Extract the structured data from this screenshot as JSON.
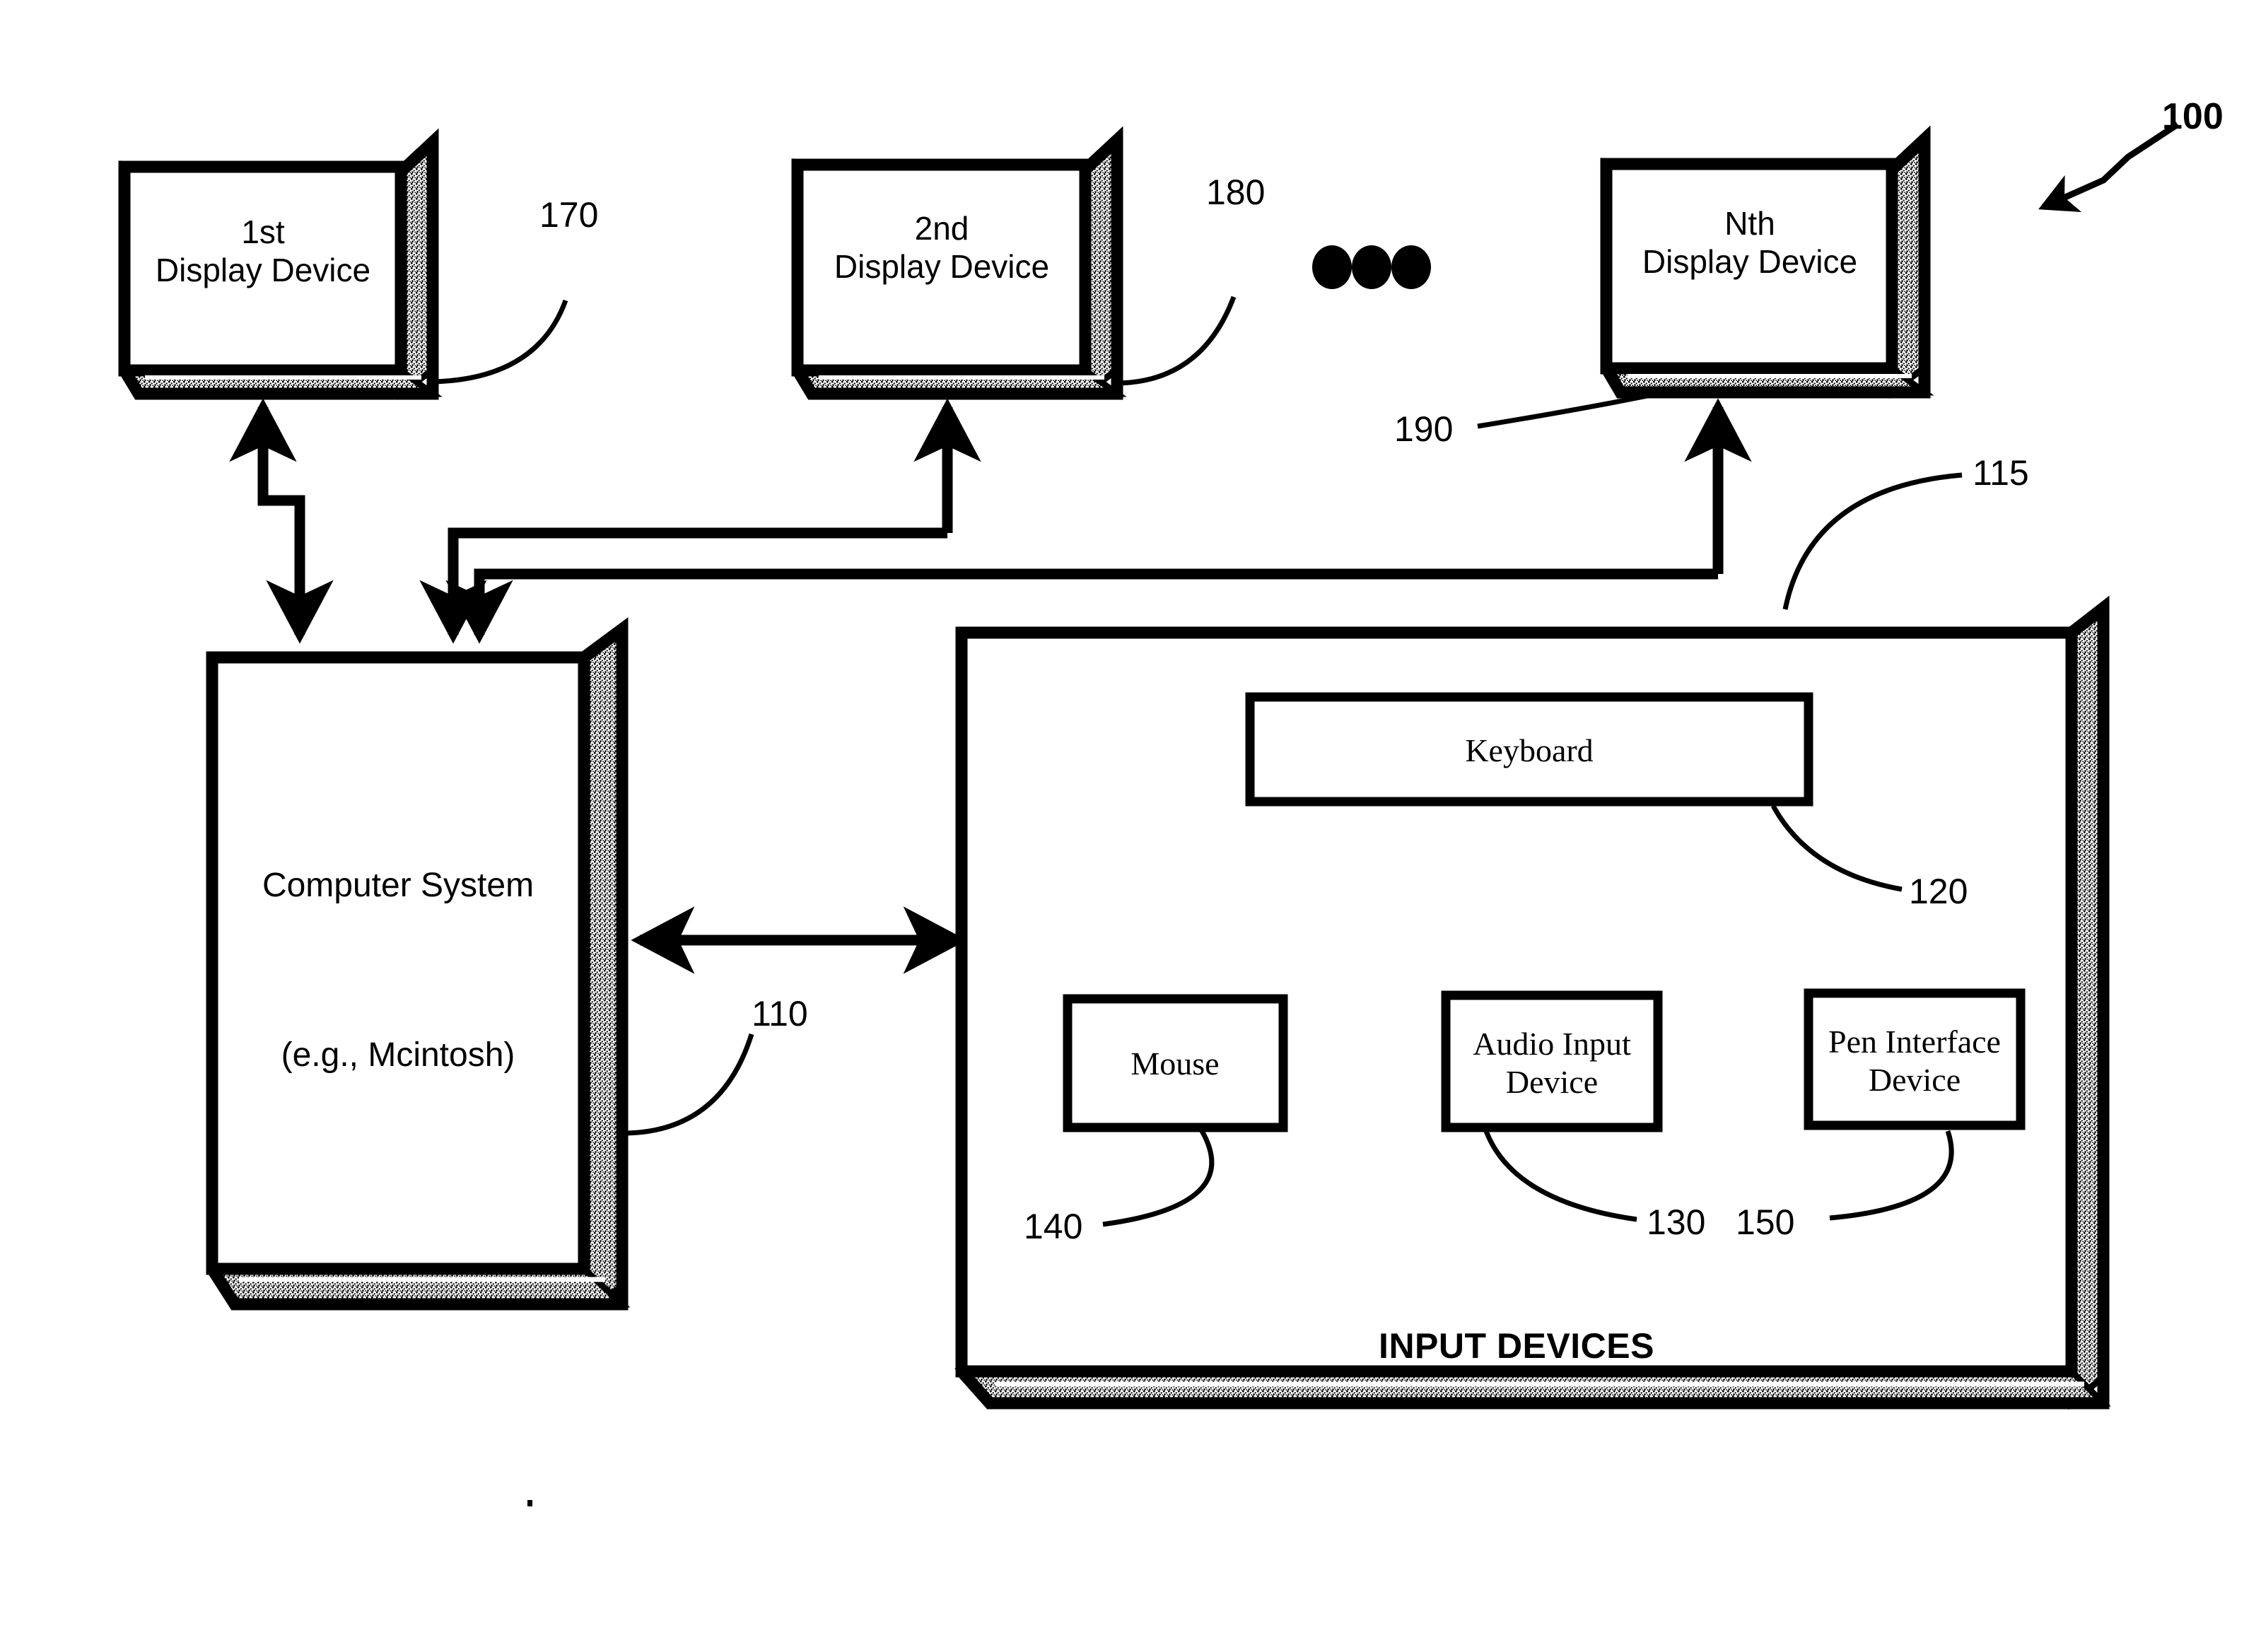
{
  "figure": {
    "reference_numeral": "100",
    "displays": [
      {
        "line1": "1st",
        "line2": "Display Device",
        "numeral": "170"
      },
      {
        "line1": "2nd",
        "line2": "Display Device",
        "numeral": "180"
      },
      {
        "line1": "Nth",
        "line2": "Display Device",
        "numeral": "190"
      }
    ],
    "ellipsis": "● ● ●",
    "computer_system": {
      "line1": "Computer System",
      "line2": "(e.g., Mcintosh)",
      "numeral": "110"
    },
    "input_devices_panel": {
      "caption": "INPUT DEVICES",
      "numeral": "115",
      "devices": [
        {
          "label": "Keyboard",
          "numeral": "120"
        },
        {
          "label": "Mouse",
          "numeral": "140"
        },
        {
          "label": "Audio Input\nDevice",
          "numeral": "130"
        },
        {
          "label": "Pen Interface\nDevice",
          "numeral": "150"
        }
      ]
    },
    "colors": {
      "ink": "#000000",
      "paper": "#ffffff",
      "hatch": "#3a3a3a"
    }
  }
}
